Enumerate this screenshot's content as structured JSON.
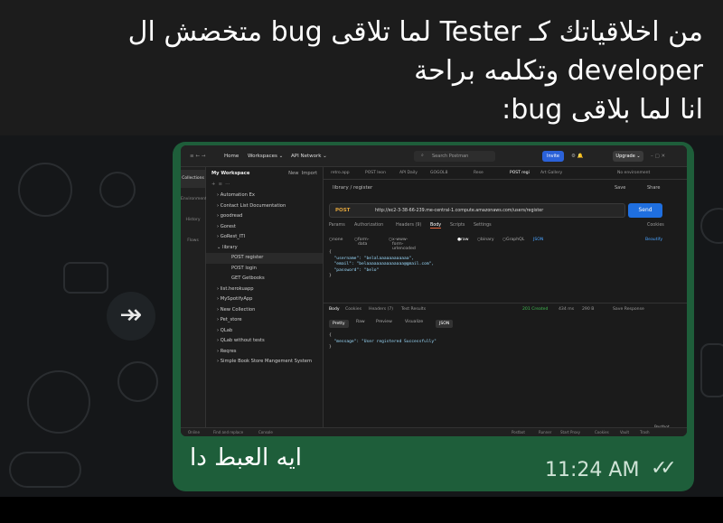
{
  "caption": {
    "lines": [
      "من اخلاقياتك كـ Tester لما تلاقى bug متخضش ال",
      "developer وتكلمه براحة",
      "انا لما بلاقى bug:"
    ]
  },
  "message": {
    "text": "ايه العبط دا",
    "time": "11:24 AM",
    "ticks": "✓✓",
    "forward_icon": "↠"
  },
  "postman": {
    "nav": {
      "home": "Home",
      "workspaces": "Workspaces ⌄",
      "api_network": "API Network ⌄"
    },
    "search_placeholder": "Search Postman",
    "invite": "Invite",
    "upgrade": "Upgrade ⌄",
    "rail": [
      "Collections",
      "Environments",
      "History",
      "Flows"
    ],
    "sidebar": {
      "workspace": "My Workspace",
      "new": "New",
      "import": "Import",
      "items": [
        "Automation Ex",
        "Contact List Documentation",
        "goodread",
        "Gorest",
        "GoRest_ITI",
        "library",
        "POST register",
        "POST login",
        "GET Getbooks",
        "list.herokuapp",
        "MySpotifyApp",
        "New Collection",
        "Pet_store",
        "QLab",
        "QLab without tests",
        "Reqres",
        "Simple Book Store Mangement System"
      ]
    },
    "tabs": [
      "retro.app",
      "POST leon",
      "API Daily",
      "GOGOL8",
      "Rese",
      "POST regi",
      "Art Gallery",
      "No environment"
    ],
    "breadcrumb": "library / register",
    "save": "Save",
    "share": "Share",
    "method": "POST",
    "url": "http://ec2-3-38-66-239.me-central-1.compute.amazonaws.com/users/register",
    "send": "Send",
    "request_tabs": [
      "Params",
      "Authorization",
      "Headers (9)",
      "Body",
      "Scripts",
      "Settings",
      "Cookies"
    ],
    "body_types": [
      "none",
      "form-data",
      "x-www-form-urlencoded",
      "raw",
      "binary",
      "GraphQL",
      "JSON",
      "Beautify"
    ],
    "request_body": [
      "{",
      "  \"username\": \"belalaaaaaaaaaaaa\",",
      "  \"email\": \"belaaaaaaaaaaaaaaa@gmail.com\",",
      "  \"password\": \"belo\"",
      "}"
    ],
    "response_tabs": [
      "Body",
      "Cookies",
      "Headers (7)",
      "Test Results"
    ],
    "status": "201 Created",
    "time": "434 ms",
    "size": "290 B",
    "save_response": "Save Response",
    "view_tabs": [
      "Pretty",
      "Raw",
      "Preview",
      "Visualize",
      "JSON"
    ],
    "response_body": [
      "{",
      "  \"message\": \"User registered Successfully\"",
      "}"
    ],
    "postbot": "Postbot",
    "footer": [
      "Online",
      "Find and replace",
      "Console",
      "Postbot",
      "Runner",
      "Start Proxy",
      "Cookies",
      "Vault",
      "Trash"
    ]
  }
}
